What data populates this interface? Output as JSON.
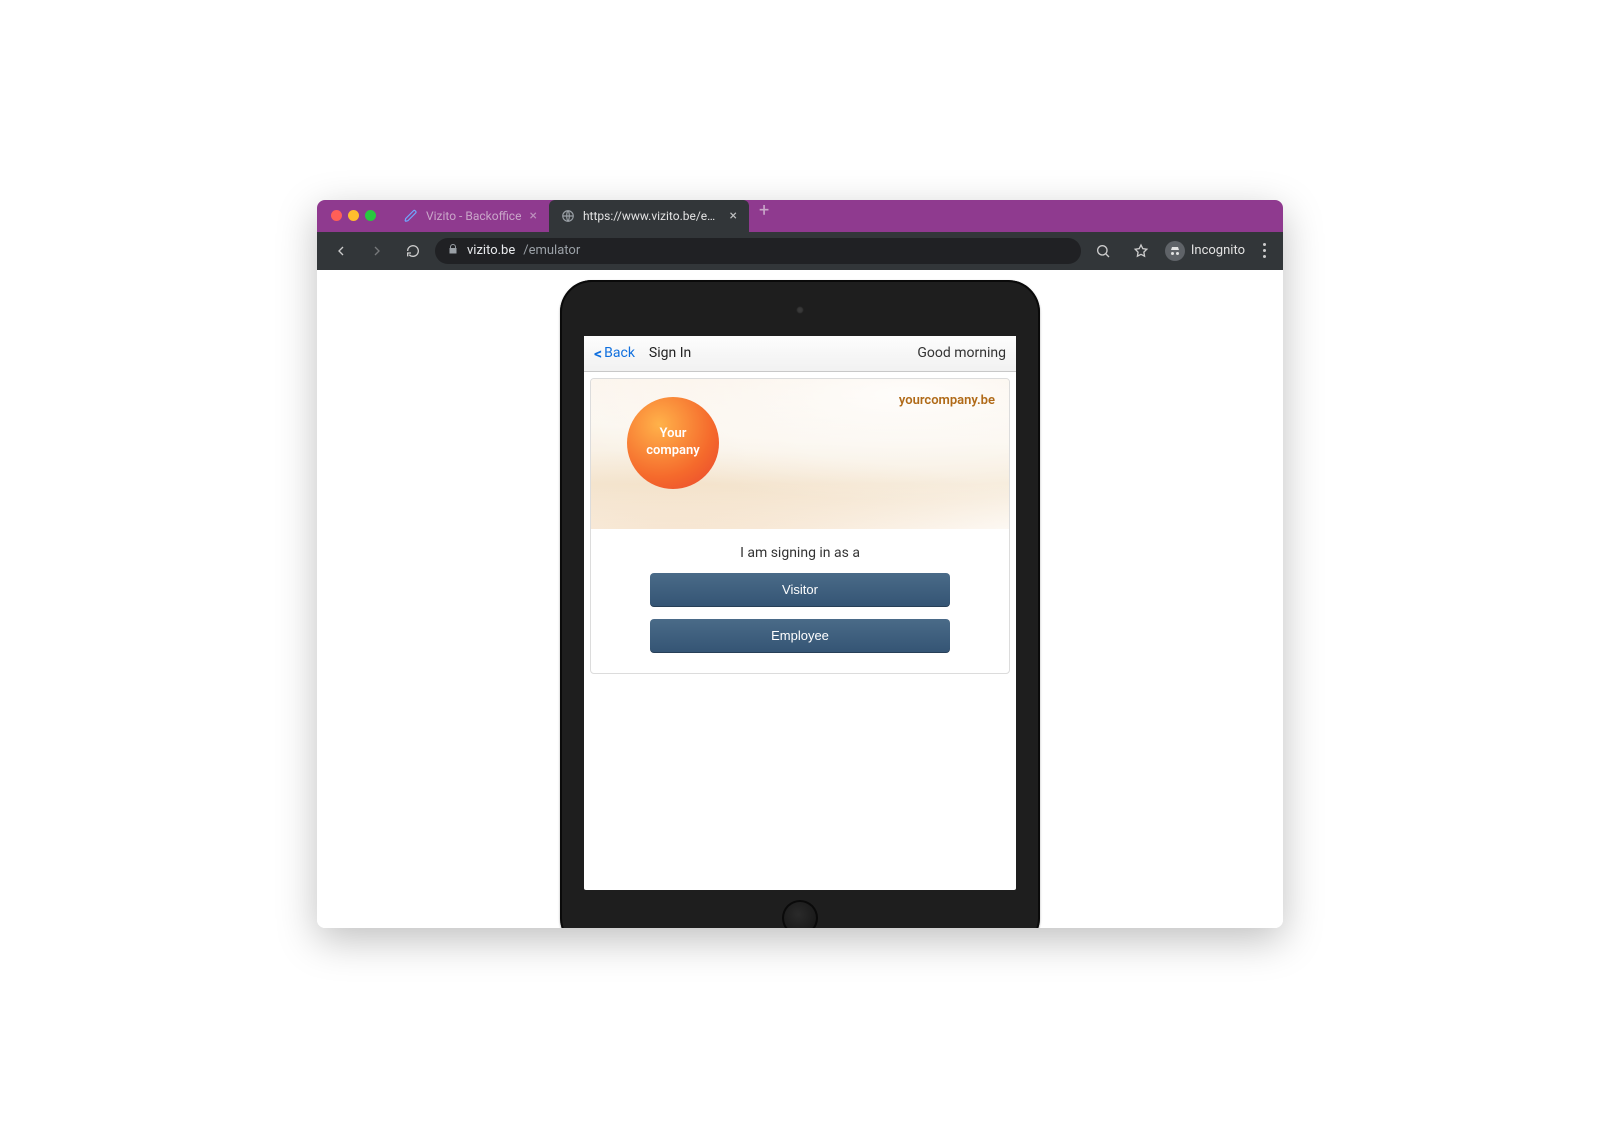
{
  "browser": {
    "tabs": [
      {
        "title": "Vizito - Backoffice",
        "active": false
      },
      {
        "title": "https://www.vizito.be/emulator",
        "active": true
      }
    ],
    "url_display": {
      "domain": "vizito.be",
      "path": "/emulator"
    },
    "incognito_label": "Incognito"
  },
  "app": {
    "back_label": "Back",
    "signin_label": "Sign In",
    "greeting": "Good morning",
    "banner": {
      "logo_line1": "Your",
      "logo_line2": "company",
      "company_url": "yourcompany.be"
    },
    "prompt": "I am signing in as a",
    "buttons": {
      "visitor": "Visitor",
      "employee": "Employee"
    }
  }
}
